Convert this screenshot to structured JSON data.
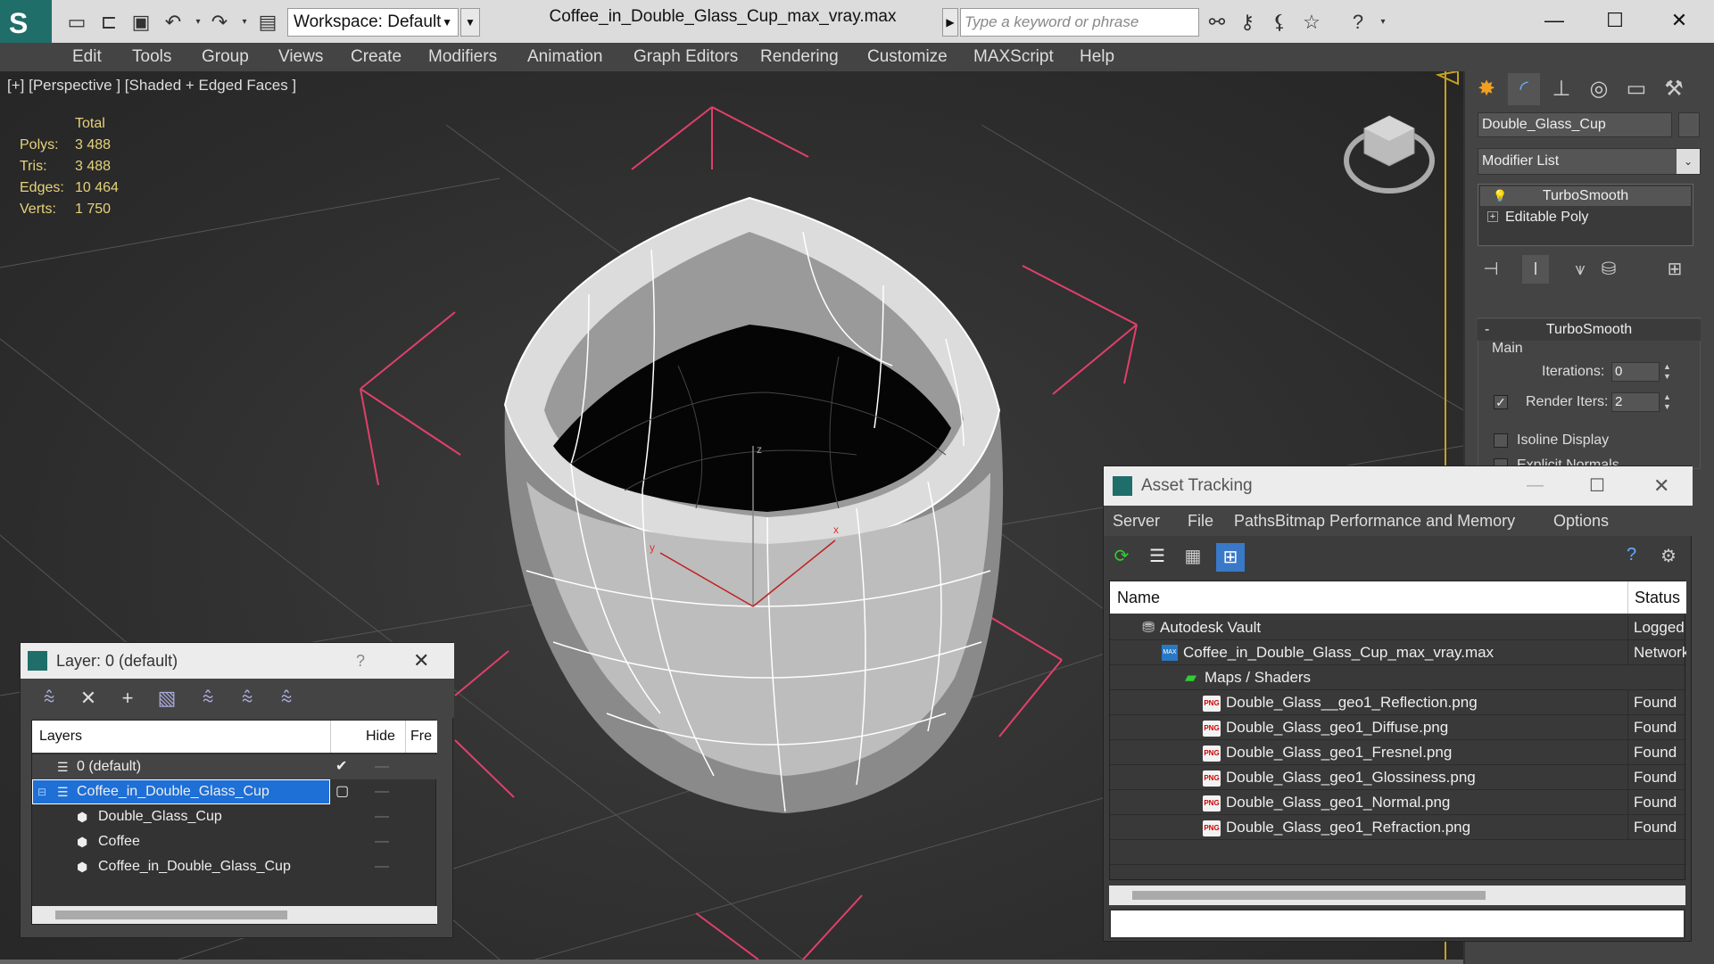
{
  "window": {
    "title": "Coffee_in_Double_Glass_Cup_max_vray.max",
    "workspace": "Workspace: Default",
    "search_placeholder": "Type a keyword or phrase"
  },
  "menu": [
    "Edit",
    "Tools",
    "Group",
    "Views",
    "Create",
    "Modifiers",
    "Animation",
    "Graph Editors",
    "Rendering",
    "Customize",
    "MAXScript",
    "Help"
  ],
  "viewport": {
    "label": "[+] [Perspective ] [Shaded + Edged Faces ]",
    "stats_header": "Total",
    "stats": [
      {
        "k": "Polys:",
        "v": "3 488"
      },
      {
        "k": "Tris:",
        "v": "3 488"
      },
      {
        "k": "Edges:",
        "v": "10 464"
      },
      {
        "k": "Verts:",
        "v": "1 750"
      }
    ],
    "axis_x": "x",
    "axis_y": "y",
    "axis_z": "z"
  },
  "command_panel": {
    "object_name": "Double_Glass_Cup",
    "modifier_list": "Modifier List",
    "stack": [
      "TurboSmooth",
      "Editable Poly"
    ],
    "rollout_title": "TurboSmooth",
    "group_main": "Main",
    "iterations_label": "Iterations:",
    "iterations_value": "0",
    "render_iters_label": "Render Iters:",
    "render_iters_value": "2",
    "isoline_label": "Isoline Display",
    "explicit_label": "Explicit Normals"
  },
  "layer_dialog": {
    "title": "Layer: 0 (default)",
    "help": "?",
    "col_layers": "Layers",
    "col_hide": "Hide",
    "col_freeze": "Fre",
    "rows": [
      {
        "name": "0 (default)",
        "indent": 0
      },
      {
        "name": "Coffee_in_Double_Glass_Cup",
        "indent": 0
      },
      {
        "name": "Double_Glass_Cup",
        "indent": 1
      },
      {
        "name": "Coffee",
        "indent": 1
      },
      {
        "name": "Coffee_in_Double_Glass_Cup",
        "indent": 1
      }
    ]
  },
  "asset_dialog": {
    "title": "Asset Tracking",
    "menu": [
      "Server",
      "File",
      "Paths",
      "Bitmap Performance and Memory",
      "Options"
    ],
    "col_name": "Name",
    "col_status": "Status",
    "rows": [
      {
        "name": "Autodesk Vault",
        "status": "Logged",
        "indent": 0
      },
      {
        "name": "Coffee_in_Double_Glass_Cup_max_vray.max",
        "status": "Network",
        "indent": 1
      },
      {
        "name": "Maps / Shaders",
        "status": "",
        "indent": 2
      },
      {
        "name": "Double_Glass__geo1_Reflection.png",
        "status": "Found",
        "indent": 3
      },
      {
        "name": "Double_Glass_geo1_Diffuse.png",
        "status": "Found",
        "indent": 3
      },
      {
        "name": "Double_Glass_geo1_Fresnel.png",
        "status": "Found",
        "indent": 3
      },
      {
        "name": "Double_Glass_geo1_Glossiness.png",
        "status": "Found",
        "indent": 3
      },
      {
        "name": "Double_Glass_geo1_Normal.png",
        "status": "Found",
        "indent": 3
      },
      {
        "name": "Double_Glass_geo1_Refraction.png",
        "status": "Found",
        "indent": 3
      }
    ]
  },
  "colors": {
    "accent_teal": "#1f6e6a",
    "selection_blue": "#1e6fd6",
    "bound_pink": "#e0406a",
    "stats_yellow": "#e6d27a"
  }
}
